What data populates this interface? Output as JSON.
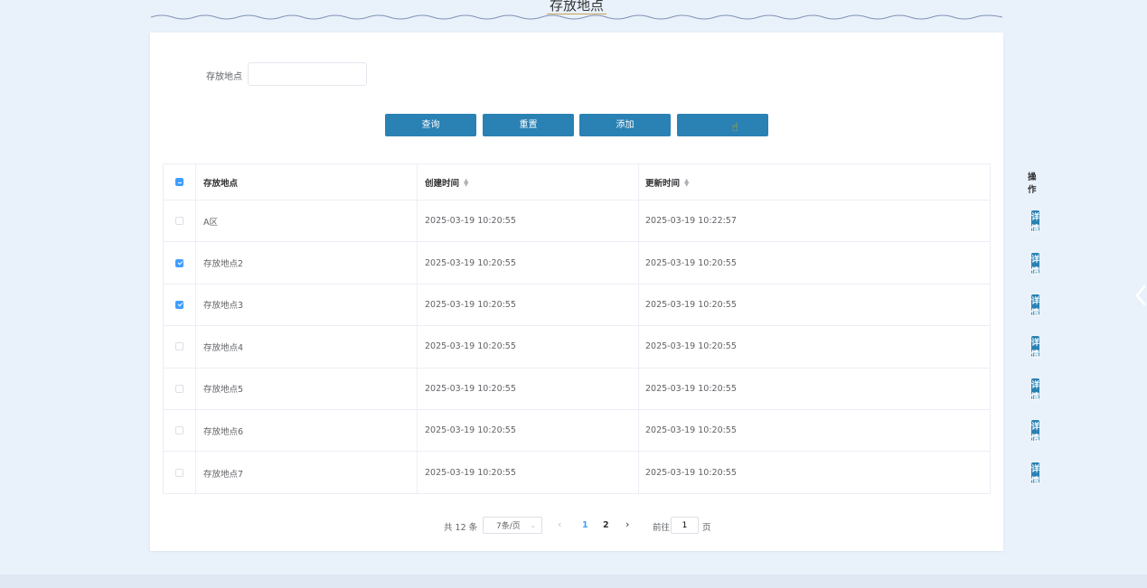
{
  "header": {
    "title": "存放地点"
  },
  "search": {
    "label": "存放地点",
    "value": "",
    "placeholder": ""
  },
  "buttons": {
    "query": "查询",
    "reset": "重置",
    "add": "添加",
    "delete": ""
  },
  "table": {
    "columns": [
      "存放地点",
      "创建时间",
      "更新时间",
      "操作"
    ],
    "detail_label": "详情",
    "rows": [
      {
        "checked": false,
        "location": "A区",
        "created": "2025-03-19 10:20:55",
        "updated": "2025-03-19 10:22:57"
      },
      {
        "checked": true,
        "location": "存放地点2",
        "created": "2025-03-19 10:20:55",
        "updated": "2025-03-19 10:20:55"
      },
      {
        "checked": true,
        "location": "存放地点3",
        "created": "2025-03-19 10:20:55",
        "updated": "2025-03-19 10:20:55"
      },
      {
        "checked": false,
        "location": "存放地点4",
        "created": "2025-03-19 10:20:55",
        "updated": "2025-03-19 10:20:55"
      },
      {
        "checked": false,
        "location": "存放地点5",
        "created": "2025-03-19 10:20:55",
        "updated": "2025-03-19 10:20:55"
      },
      {
        "checked": false,
        "location": "存放地点6",
        "created": "2025-03-19 10:20:55",
        "updated": "2025-03-19 10:20:55"
      },
      {
        "checked": false,
        "location": "存放地点7",
        "created": "2025-03-19 10:20:55",
        "updated": "2025-03-19 10:20:55"
      }
    ]
  },
  "pagination": {
    "total_text": "共 12 条",
    "page_size": "7条/页",
    "pages": [
      "1",
      "2"
    ],
    "current_page": "1",
    "goto_label": "前往",
    "goto_value": "1",
    "page_suffix": "页"
  },
  "colors": {
    "primary_button": "#2a81b4",
    "active": "#409eff",
    "background": "#e9f1fb"
  },
  "icons": {
    "sort": "sort-caret-icon",
    "prev": "chevron-left-icon",
    "next": "chevron-right-icon",
    "cursor": "hand-pointer-icon",
    "side": "chevron-left-icon"
  }
}
